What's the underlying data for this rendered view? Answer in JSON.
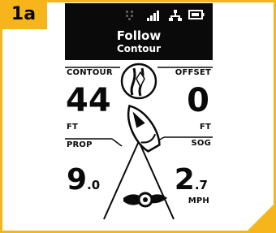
{
  "figure": {
    "tag": "1a"
  },
  "status_icons": [
    "sonar-icon",
    "signal-bars-icon",
    "network-icon",
    "battery-icon"
  ],
  "header": {
    "mode": "Follow",
    "submode": "Contour"
  },
  "contour": {
    "label": "CONTOUR",
    "value": "44",
    "unit": "FT"
  },
  "offset": {
    "label": "OFFSET",
    "value": "0",
    "unit": "FT"
  },
  "prop": {
    "label": "PROP",
    "value_int": "9",
    "value_dec": ".0"
  },
  "sog": {
    "label": "SOG",
    "value_int": "2",
    "value_dec": ".7",
    "unit": "MPH"
  },
  "colors": {
    "accent": "#f6b51a",
    "screen_bg": "#0a0a0a",
    "text": "#0a0a0a"
  }
}
